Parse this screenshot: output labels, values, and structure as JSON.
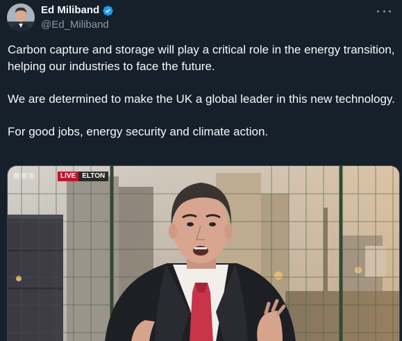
{
  "tweet": {
    "author": {
      "display_name": "Ed Miliband",
      "handle": "@Ed_Miliband",
      "verified": true
    },
    "paragraphs": [
      "Carbon capture and storage will play a critical role in the energy transition, helping our industries to face the future.",
      "We are determined to make the UK a global leader in this new technology.",
      "For good jobs, energy security and climate action."
    ],
    "media": {
      "broadcast_logo": [
        "B",
        "B",
        "C"
      ],
      "live_label": "LIVE",
      "location_label": "ELTON"
    }
  },
  "colors": {
    "background": "#15202b",
    "text_primary": "#f7f9f9",
    "text_secondary": "#8b98a5",
    "verified_blue": "#1d9bf0",
    "live_red": "#c8102e"
  },
  "icons": {
    "verified": "verified-badge-icon",
    "more": "more-options-icon"
  }
}
